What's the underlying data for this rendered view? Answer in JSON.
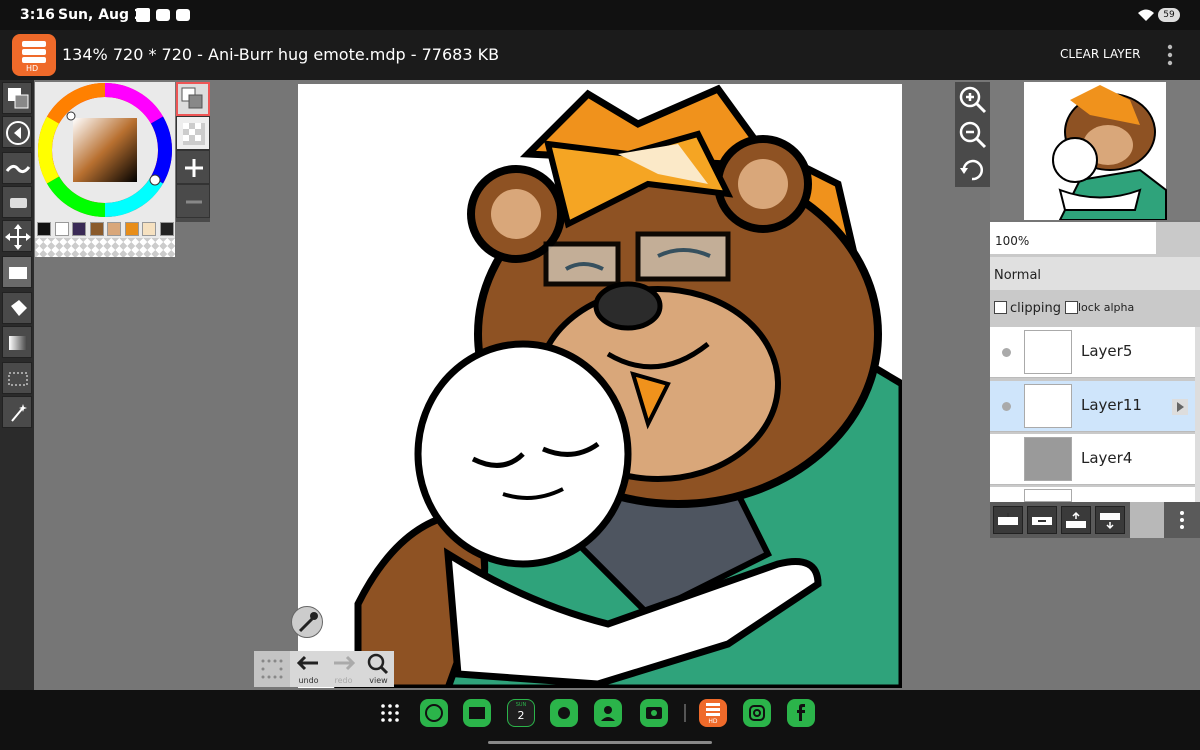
{
  "status_bar": {
    "time": "3:16",
    "date": "Sun, Aug 2",
    "battery": "59"
  },
  "app": {
    "logo_text": "HD",
    "title": "134% 720 * 720 - Ani-Burr hug emote.mdp - 77683 KB",
    "clear_layer_label": "CLEAR LAYER"
  },
  "colors": {
    "accent": "#ef6a2a",
    "selected_layer_bg": "#cfe5fb"
  },
  "palette": [
    "#111111",
    "#ffffff",
    "#3a2a56",
    "#8a5a2b",
    "#d9a77a",
    "#e88e1a",
    "#f6e1c0",
    "#222222"
  ],
  "layers": {
    "opacity": "100%",
    "blend_mode": "Normal",
    "clipping_label": "clipping",
    "lock_alpha_label": "lock alpha",
    "items": [
      {
        "name": "Layer5",
        "selected": false
      },
      {
        "name": "Layer11",
        "selected": true
      },
      {
        "name": "Layer4",
        "selected": false
      }
    ]
  },
  "bottom_tools": {
    "undo": "undo",
    "redo": "redo",
    "view": "view"
  },
  "dock": {
    "calendar_day_label": "SUN",
    "calendar_day": "2",
    "hd_label": "HD"
  }
}
